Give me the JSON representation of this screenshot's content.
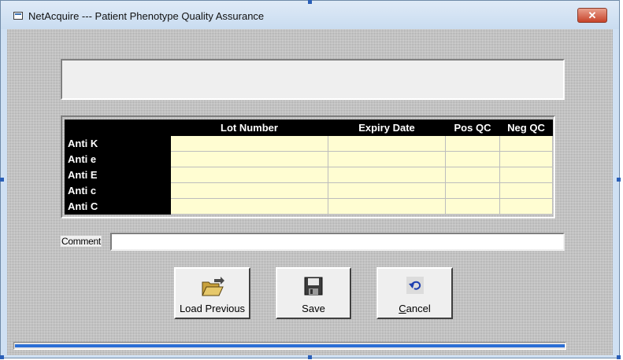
{
  "window": {
    "title": "NetAcquire --- Patient Phenotype Quality Assurance",
    "close_glyph": "✕"
  },
  "grid": {
    "columns": [
      "",
      "Lot Number",
      "Expiry Date",
      "Pos QC",
      "Neg QC"
    ],
    "rows": [
      {
        "label": "Anti K",
        "cells": [
          "",
          "",
          "",
          ""
        ]
      },
      {
        "label": "Anti e",
        "cells": [
          "",
          "",
          "",
          ""
        ]
      },
      {
        "label": "Anti E",
        "cells": [
          "",
          "",
          "",
          ""
        ]
      },
      {
        "label": "Anti c",
        "cells": [
          "",
          "",
          "",
          ""
        ]
      },
      {
        "label": "Anti C",
        "cells": [
          "",
          "",
          "",
          ""
        ]
      }
    ]
  },
  "comment": {
    "label": "Comment",
    "value": ""
  },
  "buttons": {
    "load_previous": {
      "label": "Load Previous",
      "icon": "folder-open-icon"
    },
    "save": {
      "label": "Save",
      "icon": "floppy-disk-icon"
    },
    "cancel": {
      "label_prefix": "",
      "label_underlined": "C",
      "label_rest": "ancel",
      "icon": "undo-icon"
    }
  },
  "progress": {
    "value_percent": 100
  },
  "colors": {
    "grid_cell": "#fffdd2",
    "header_bg": "#000000",
    "progress_fill": "#2c6fd6"
  }
}
